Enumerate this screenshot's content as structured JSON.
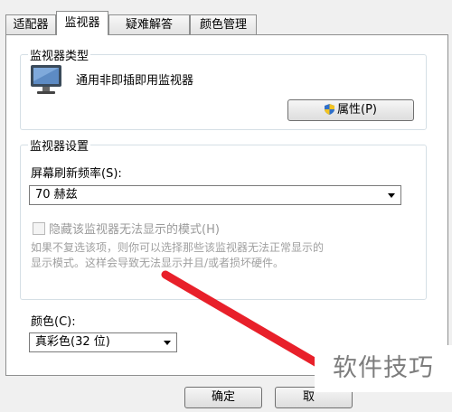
{
  "tabs": [
    {
      "label": "适配器"
    },
    {
      "label": "监视器"
    },
    {
      "label": "疑难解答"
    },
    {
      "label": "颜色管理"
    }
  ],
  "active_tab": "监视器",
  "monitor_type": {
    "title": "监视器类型",
    "device_name": "通用非即插即用监视器",
    "properties_button": "属性(P)"
  },
  "monitor_settings": {
    "title": "监视器设置",
    "refresh_label": "屏幕刷新频率(S):",
    "refresh_value": "70 赫兹",
    "hide_modes_label": "隐藏该监视器无法显示的模式(H)",
    "hide_modes_checked": false,
    "description_line1": "如果不复选该项，则你可以选择那些该监视器无法正常显示的",
    "description_line2": "显示模式。这样会导致无法显示并且/或者损坏硬件。"
  },
  "colors": {
    "label": "颜色(C):",
    "value": "真彩色(32 位)"
  },
  "footer": {
    "ok_label": "确定",
    "cancel_label": "取"
  },
  "watermark": "软件技巧",
  "accent_colors": {
    "annotation_red": "#e8202a",
    "group_border": "#d5dfe5"
  }
}
